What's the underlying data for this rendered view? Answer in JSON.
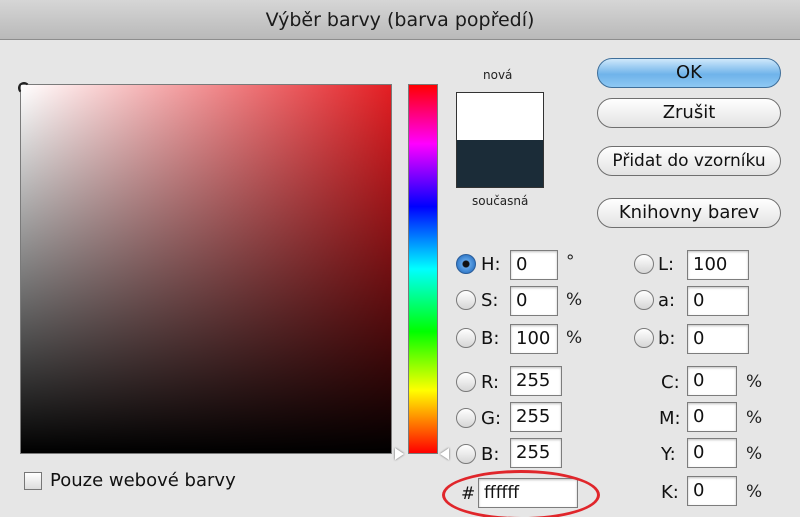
{
  "title": "Výběr barvy (barva popředí)",
  "preview": {
    "new_label": "nová",
    "current_label": "současná",
    "new_color": "#ffffff",
    "current_color": "#1b2c38"
  },
  "buttons": {
    "ok": "OK",
    "cancel": "Zrušit",
    "add_swatch": "Přidat do vzorníku",
    "libraries": "Knihovny barev"
  },
  "hsb": {
    "h": {
      "label": "H:",
      "value": "0",
      "unit": "°",
      "selected": true
    },
    "s": {
      "label": "S:",
      "value": "0",
      "unit": "%"
    },
    "b": {
      "label": "B:",
      "value": "100",
      "unit": "%"
    }
  },
  "rgb": {
    "r": {
      "label": "R:",
      "value": "255"
    },
    "g": {
      "label": "G:",
      "value": "255"
    },
    "b": {
      "label": "B:",
      "value": "255"
    }
  },
  "lab": {
    "l": {
      "label": "L:",
      "value": "100"
    },
    "a": {
      "label": "a:",
      "value": "0"
    },
    "b": {
      "label": "b:",
      "value": "0"
    }
  },
  "cmyk": {
    "c": {
      "label": "C:",
      "value": "0",
      "unit": "%"
    },
    "m": {
      "label": "M:",
      "value": "0",
      "unit": "%"
    },
    "y": {
      "label": "Y:",
      "value": "0",
      "unit": "%"
    },
    "k": {
      "label": "K:",
      "value": "0",
      "unit": "%"
    }
  },
  "hex": {
    "label": "#",
    "value": "ffffff"
  },
  "web_only": {
    "label": "Pouze webové barvy",
    "checked": false
  },
  "colors": {
    "accent": "#6fb3ea",
    "highlight": "#e0262b",
    "hue_base": "#e41e23"
  }
}
